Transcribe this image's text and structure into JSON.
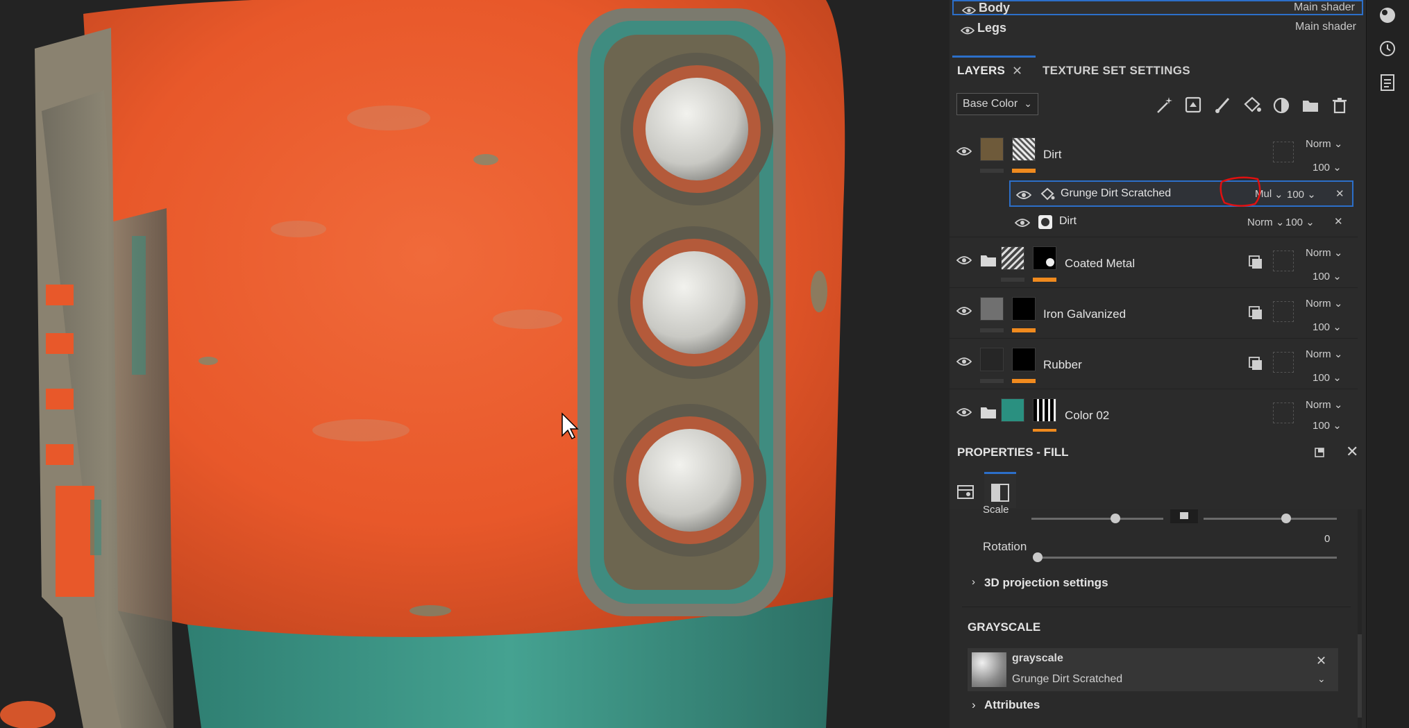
{
  "texture_sets": [
    {
      "name": "Body",
      "shader": "Main shader"
    },
    {
      "name": "Legs",
      "shader": "Main shader"
    }
  ],
  "tabs": {
    "layers": "LAYERS",
    "layers_close": "✕",
    "texture_set_settings": "TEXTURE SET SETTINGS"
  },
  "channel_select": {
    "value": "Base Color"
  },
  "toolbar_icons": [
    "magic-wand-icon",
    "add-fill-layer-icon",
    "paint-brush-icon",
    "fill-bucket-icon",
    "effects-icon",
    "folder-icon",
    "trash-icon"
  ],
  "layers": [
    {
      "name": "Dirt",
      "blend": "Norm",
      "opacity": "100",
      "type": "fill",
      "children": [
        {
          "name": "Grunge Dirt Scratched",
          "blend": "Mul",
          "opacity": "100",
          "selected": true
        },
        {
          "name": "Dirt",
          "blend": "Norm",
          "opacity": "100"
        }
      ]
    },
    {
      "name": "Coated Metal",
      "blend": "Norm",
      "opacity": "100",
      "type": "folder"
    },
    {
      "name": "Iron Galvanized",
      "blend": "Norm",
      "opacity": "100",
      "type": "fill"
    },
    {
      "name": "Rubber",
      "blend": "Norm",
      "opacity": "100",
      "type": "fill"
    },
    {
      "name": "Color 02",
      "blend": "Norm",
      "opacity": "100",
      "type": "folder"
    }
  ],
  "properties": {
    "title": "PROPERTIES - FILL",
    "close": "✕",
    "scale_label": "Scale",
    "rotation_label": "Rotation",
    "rotation_value": "0",
    "projection_section": "3D projection settings",
    "grayscale_section": "GRAYSCALE",
    "grayscale_name": "grayscale",
    "grayscale_resource": "Grunge Dirt Scratched",
    "attributes_section": "Attributes"
  },
  "colors": {
    "accent": "#2c6fc9",
    "annotation": "#e01010",
    "orange_bar": "#f08a1e",
    "paint": "#e8582a",
    "teal": "#3f9a8a"
  }
}
